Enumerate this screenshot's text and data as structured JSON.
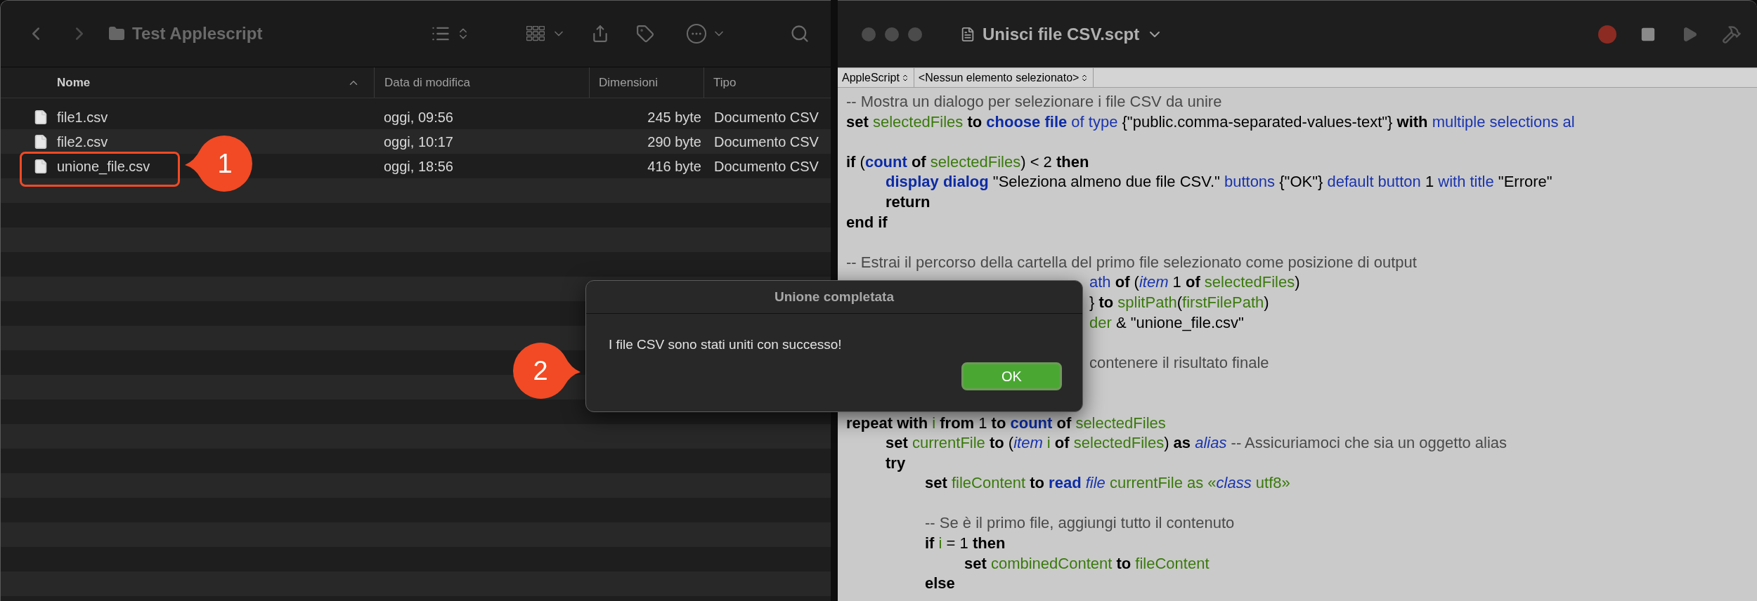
{
  "finder": {
    "title": "Test Applescript",
    "columns": [
      {
        "label": "Nome",
        "sorted": true
      },
      {
        "label": "Data di modifica",
        "sorted": false
      },
      {
        "label": "Dimensioni",
        "sorted": false
      },
      {
        "label": "Tipo",
        "sorted": false
      }
    ],
    "files": [
      {
        "name": "file1.csv",
        "modified": "oggi, 09:56",
        "size": "245 byte",
        "type": "Documento CSV",
        "highlighted": false
      },
      {
        "name": "file2.csv",
        "modified": "oggi, 10:17",
        "size": "290 byte",
        "type": "Documento CSV",
        "highlighted": false
      },
      {
        "name": "unione_file.csv",
        "modified": "oggi, 18:56",
        "size": "416 byte",
        "type": "Documento CSV",
        "highlighted": true,
        "callout": "1"
      }
    ]
  },
  "editor": {
    "title": "Unisci file CSV.scpt",
    "language": "AppleScript",
    "element": "<Nessun elemento selezionato>",
    "lines": [
      {
        "kind": "code",
        "tokens": [
          {
            "kind": "comment",
            "text": "-- Mostra un dialogo per selezionare i file CSV da unire"
          }
        ]
      },
      {
        "kind": "code",
        "tokens": [
          {
            "kind": "keyword",
            "text": "set"
          },
          {
            "kind": "variable",
            "text": " selectedFiles"
          },
          {
            "kind": "keyword",
            "text": " to"
          },
          {
            "kind": "command",
            "text": " choose file"
          },
          {
            "kind": "property",
            "text": " of type"
          },
          {
            "kind": "plain",
            "text": " {\"public.comma-separated-values-text\"} "
          },
          {
            "kind": "keyword",
            "text": "with"
          },
          {
            "kind": "property",
            "text": " multiple selections al"
          }
        ]
      },
      {
        "kind": "blank"
      },
      {
        "kind": "code",
        "tokens": [
          {
            "kind": "keyword",
            "text": "if"
          },
          {
            "kind": "plain",
            "text": " ("
          },
          {
            "kind": "command",
            "text": "count"
          },
          {
            "kind": "keyword",
            "text": " of"
          },
          {
            "kind": "variable",
            "text": " selectedFiles"
          },
          {
            "kind": "plain",
            "text": ") < 2 "
          },
          {
            "kind": "keyword",
            "text": "then"
          }
        ],
        "children": [
          {
            "kind": "code",
            "tokens": [
              {
                "kind": "command",
                "text": "display dialog"
              },
              {
                "kind": "plain",
                "text": " \"Seleziona almeno due file CSV.\" "
              },
              {
                "kind": "property",
                "text": "buttons"
              },
              {
                "kind": "plain",
                "text": " {\"OK\"} "
              },
              {
                "kind": "property",
                "text": "default button"
              },
              {
                "kind": "plain",
                "text": " 1 "
              },
              {
                "kind": "property",
                "text": "with title"
              },
              {
                "kind": "plain",
                "text": " \"Errore\""
              }
            ]
          },
          {
            "kind": "code",
            "tokens": [
              {
                "kind": "keyword",
                "text": "return"
              }
            ]
          }
        ]
      },
      {
        "kind": "code",
        "tokens": [
          {
            "kind": "keyword",
            "text": "end if"
          }
        ]
      },
      {
        "kind": "blank"
      },
      {
        "kind": "code",
        "tokens": [
          {
            "kind": "comment",
            "text": "-- Estrai il percorso della cartella del primo file selezionato come posizione di output"
          }
        ]
      },
      {
        "kind": "partial",
        "tokens": [
          {
            "kind": "property",
            "text": "ath"
          },
          {
            "kind": "keyword",
            "text": " of"
          },
          {
            "kind": "plain",
            "text": " ("
          },
          {
            "kind": "class",
            "text": "item"
          },
          {
            "kind": "plain",
            "text": " 1 "
          },
          {
            "kind": "keyword",
            "text": "of"
          },
          {
            "kind": "variable",
            "text": " selectedFiles"
          },
          {
            "kind": "plain",
            "text": ")"
          }
        ]
      },
      {
        "kind": "partial",
        "tokens": [
          {
            "kind": "plain",
            "text": "}"
          },
          {
            "kind": "keyword",
            "text": " to"
          },
          {
            "kind": "variable",
            "text": " splitPath"
          },
          {
            "kind": "plain",
            "text": "("
          },
          {
            "kind": "variable",
            "text": "firstFilePath"
          },
          {
            "kind": "plain",
            "text": ")"
          }
        ]
      },
      {
        "kind": "partial",
        "tokens": [
          {
            "kind": "variable",
            "text": "der"
          },
          {
            "kind": "plain",
            "text": " & \"unione_file.csv\""
          }
        ]
      },
      {
        "kind": "blank"
      },
      {
        "kind": "partial",
        "tokens": [
          {
            "kind": "comment",
            "text": "contenere il risultato finale"
          }
        ]
      },
      {
        "kind": "blank"
      },
      {
        "kind": "blank"
      },
      {
        "kind": "code",
        "tokens": [
          {
            "kind": "keyword",
            "text": "repeat with"
          },
          {
            "kind": "variable",
            "text": " i"
          },
          {
            "kind": "keyword",
            "text": " from"
          },
          {
            "kind": "plain",
            "text": " 1 "
          },
          {
            "kind": "keyword",
            "text": "to"
          },
          {
            "kind": "command",
            "text": " count"
          },
          {
            "kind": "keyword",
            "text": " of"
          },
          {
            "kind": "variable",
            "text": " selectedFiles"
          }
        ],
        "children": [
          {
            "kind": "code",
            "tokens": [
              {
                "kind": "keyword",
                "text": "set"
              },
              {
                "kind": "variable",
                "text": " currentFile"
              },
              {
                "kind": "keyword",
                "text": " to"
              },
              {
                "kind": "plain",
                "text": " ("
              },
              {
                "kind": "class",
                "text": "item"
              },
              {
                "kind": "variable",
                "text": " i"
              },
              {
                "kind": "keyword",
                "text": " of"
              },
              {
                "kind": "variable",
                "text": " selectedFiles"
              },
              {
                "kind": "plain",
                "text": ") "
              },
              {
                "kind": "keyword",
                "text": "as"
              },
              {
                "kind": "class",
                "text": " alias"
              },
              {
                "kind": "comment",
                "text": " -- Assicuriamoci che sia un oggetto alias"
              }
            ]
          },
          {
            "kind": "code",
            "tokens": [
              {
                "kind": "keyword",
                "text": "try"
              }
            ],
            "children": [
              {
                "kind": "code",
                "tokens": [
                  {
                    "kind": "keyword",
                    "text": "set"
                  },
                  {
                    "kind": "variable",
                    "text": " fileContent"
                  },
                  {
                    "kind": "keyword",
                    "text": " to"
                  },
                  {
                    "kind": "command",
                    "text": " read"
                  },
                  {
                    "kind": "class",
                    "text": " file"
                  },
                  {
                    "kind": "variable",
                    "text": " currentFile as «"
                  },
                  {
                    "kind": "class",
                    "text": "class"
                  },
                  {
                    "kind": "variable",
                    "text": " utf8»"
                  }
                ]
              },
              {
                "kind": "blank"
              },
              {
                "kind": "code",
                "tokens": [
                  {
                    "kind": "comment",
                    "text": "-- Se è il primo file, aggiungi tutto il contenuto"
                  }
                ]
              },
              {
                "kind": "code",
                "tokens": [
                  {
                    "kind": "keyword",
                    "text": "if"
                  },
                  {
                    "kind": "variable",
                    "text": " i"
                  },
                  {
                    "kind": "plain",
                    "text": " = 1 "
                  },
                  {
                    "kind": "keyword",
                    "text": "then"
                  }
                ],
                "children": [
                  {
                    "kind": "code",
                    "tokens": [
                      {
                        "kind": "keyword",
                        "text": "set"
                      },
                      {
                        "kind": "variable",
                        "text": " combinedContent"
                      },
                      {
                        "kind": "keyword",
                        "text": " to"
                      },
                      {
                        "kind": "variable",
                        "text": " fileContent"
                      }
                    ]
                  }
                ]
              },
              {
                "kind": "code",
                "tokens": [
                  {
                    "kind": "keyword",
                    "text": "else"
                  }
                ]
              }
            ]
          }
        ]
      }
    ]
  },
  "dialog": {
    "title": "Unione completata",
    "message": "I file CSV sono stati uniti con successo!",
    "button": "OK",
    "callout": "2"
  }
}
